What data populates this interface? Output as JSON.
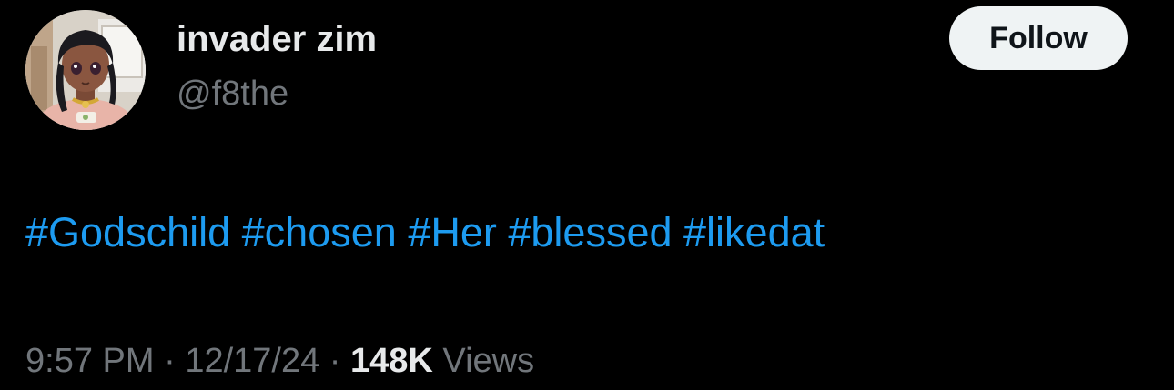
{
  "author": {
    "display_name": "invader zim",
    "handle": "@f8the",
    "avatar_icon": "anime-girl-avatar"
  },
  "follow_button": {
    "label": "Follow"
  },
  "tweet": {
    "hashtags": [
      "#Godschild",
      "#chosen",
      "#Her",
      "#blessed",
      "#likedat"
    ]
  },
  "meta": {
    "time": "9:57 PM",
    "separator": "·",
    "date": "12/17/24",
    "views_count": "148K",
    "views_label": "Views"
  },
  "colors": {
    "background": "#000000",
    "primary_text": "#e7e9ea",
    "secondary_text": "#71767b",
    "link": "#1d9bf0",
    "button_bg": "#eff3f4",
    "button_text": "#0f1419"
  }
}
